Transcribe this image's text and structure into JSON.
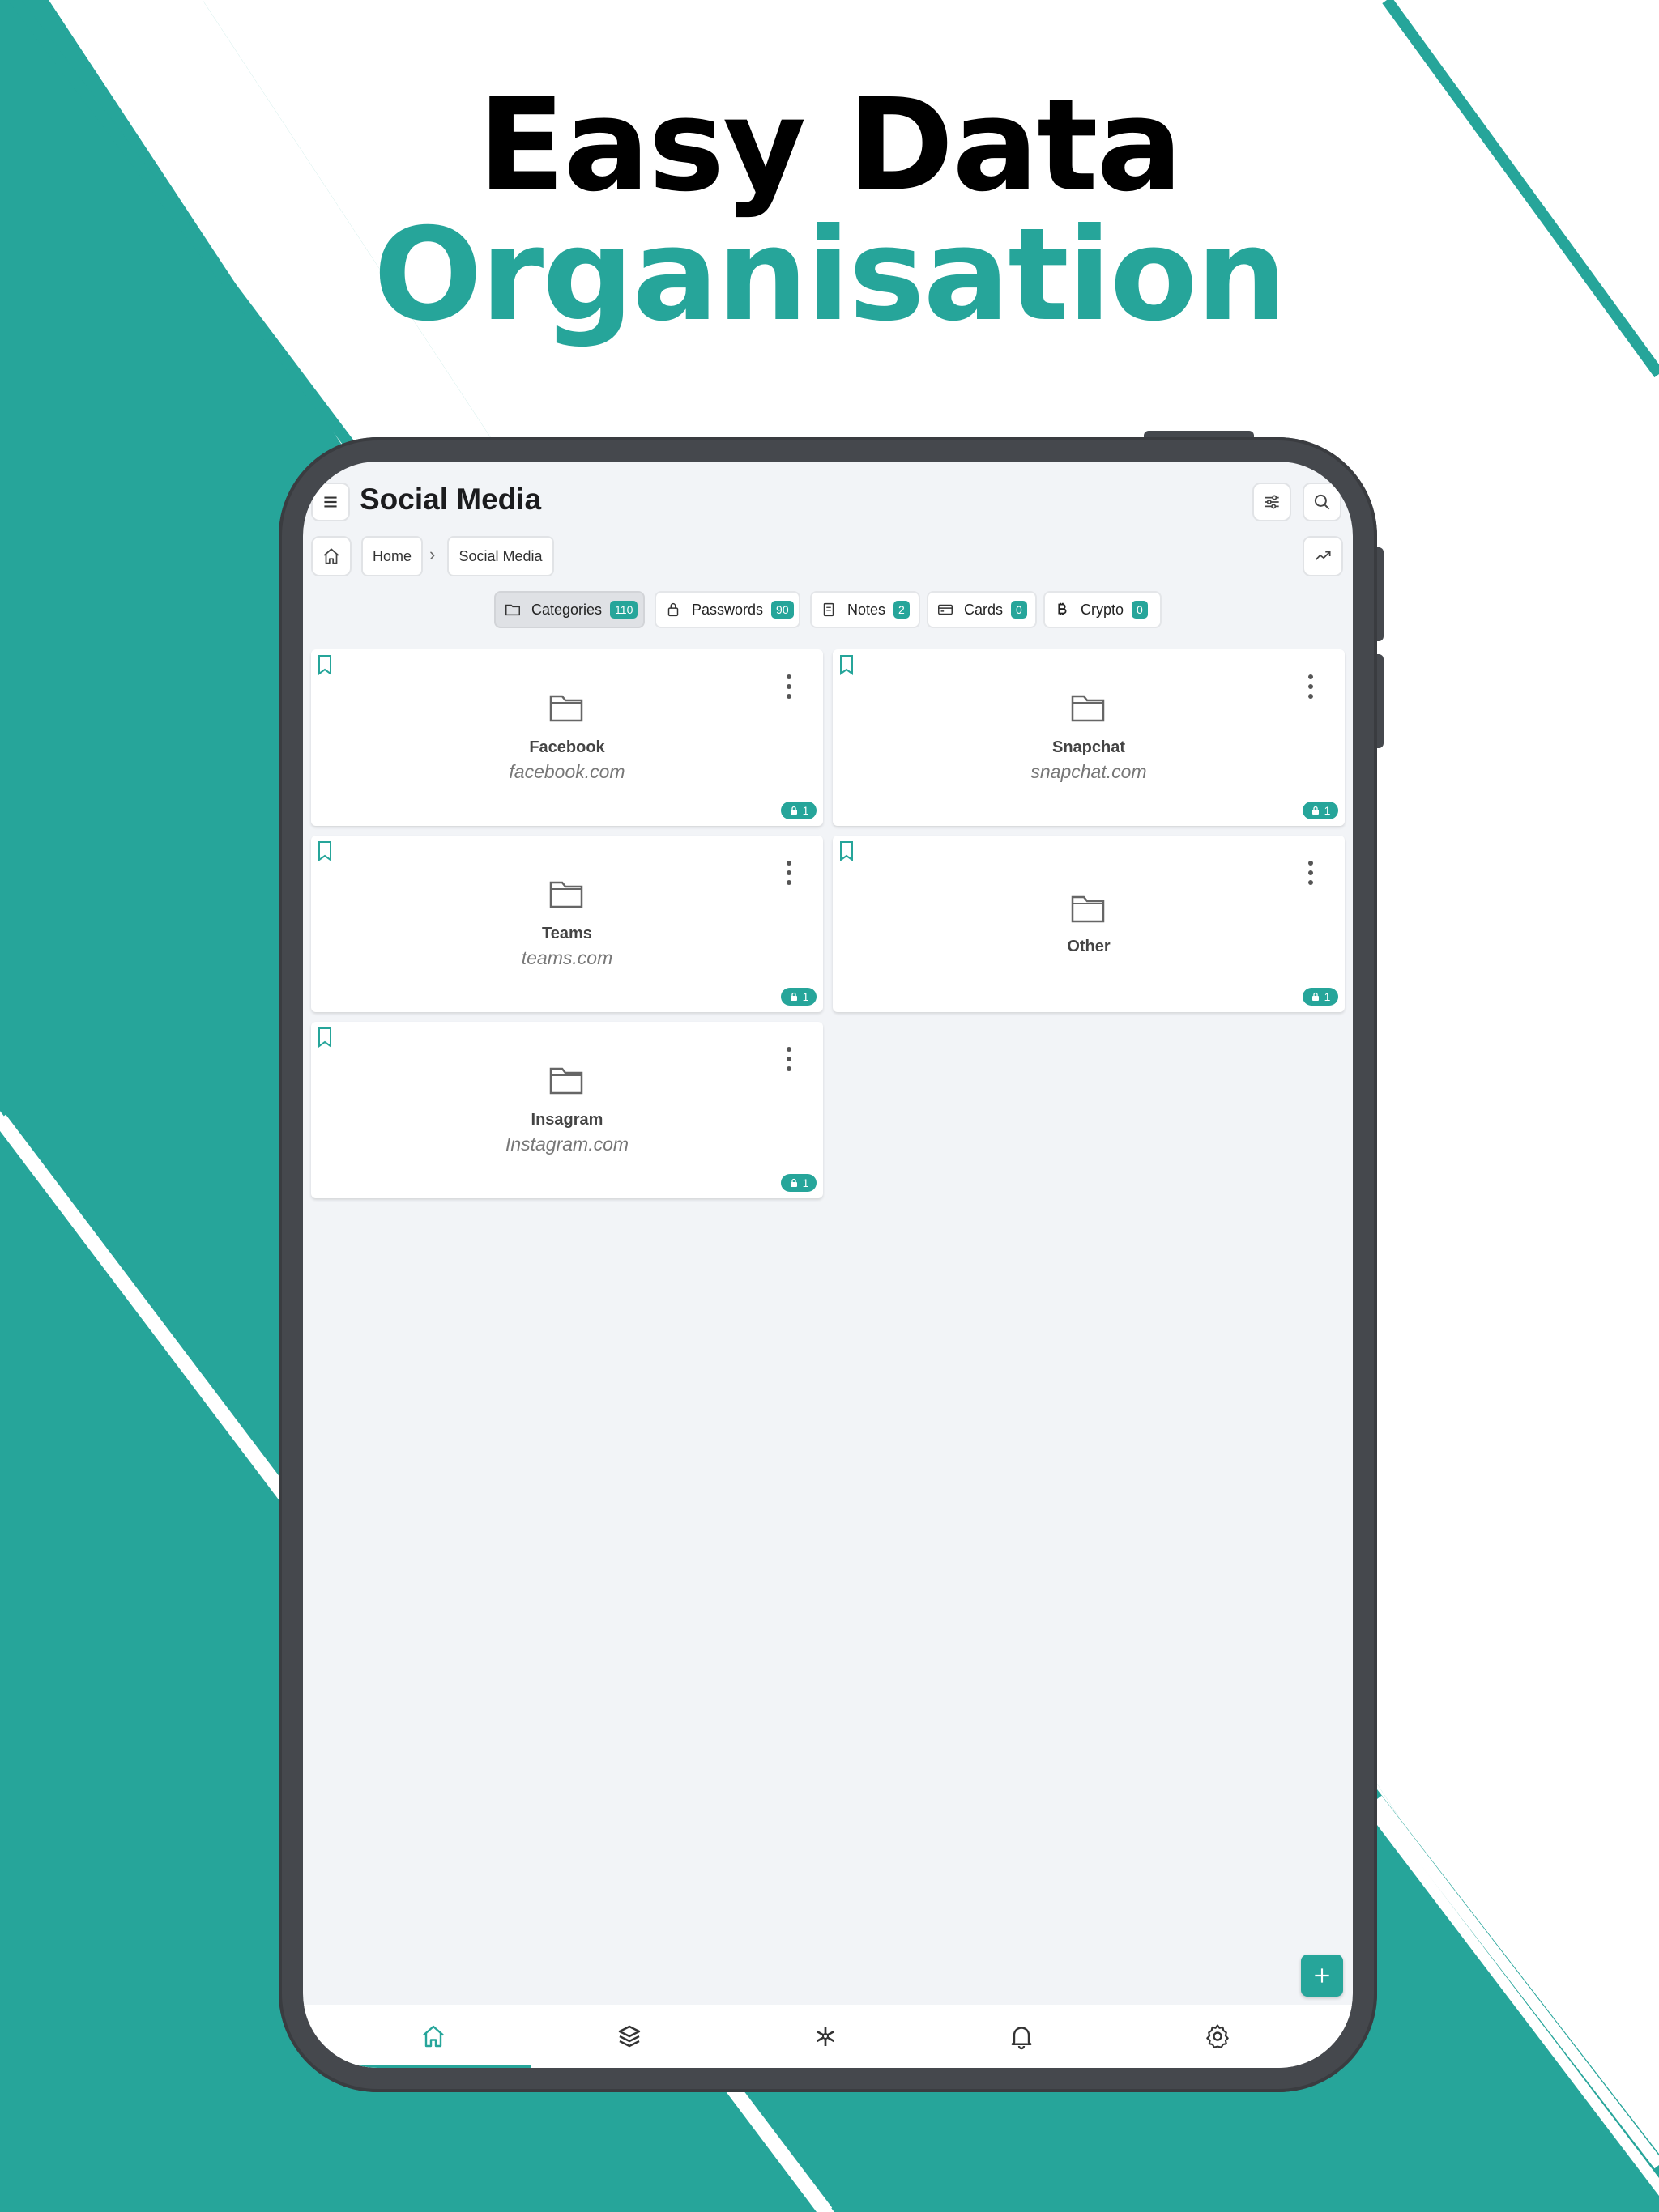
{
  "promo": {
    "headline_line1": "Easy Data",
    "headline_line2": "Organisation"
  },
  "colors": {
    "accent": "#26a59a",
    "headline_dark": "#000000",
    "device_frame": "#45484d",
    "screen_bg": "#f2f4f7"
  },
  "app": {
    "title": "Social Media",
    "header_left_icon": "menu-icon",
    "header_right_icons": [
      "sliders-icon",
      "search-icon"
    ],
    "breadcrumb": {
      "home_icon": "home-icon",
      "items": [
        "Home",
        "Social Media"
      ],
      "separator": "›",
      "right_icon": "trending-up-icon"
    },
    "tabs": [
      {
        "label": "Categories",
        "count": "110",
        "icon": "folder-icon",
        "active": true
      },
      {
        "label": "Passwords",
        "count": "90",
        "icon": "lock-icon",
        "active": false
      },
      {
        "label": "Notes",
        "count": "2",
        "icon": "note-icon",
        "active": false
      },
      {
        "label": "Cards",
        "count": "0",
        "icon": "card-icon",
        "active": false
      },
      {
        "label": "Crypto",
        "count": "0",
        "icon": "bitcoin-icon",
        "active": false
      }
    ],
    "categories": [
      {
        "name": "Facebook",
        "url": "facebook.com",
        "count": "1"
      },
      {
        "name": "Snapchat",
        "url": "snapchat.com",
        "count": "1"
      },
      {
        "name": "Teams",
        "url": "teams.com",
        "count": "1"
      },
      {
        "name": "Other",
        "url": "",
        "count": "1"
      },
      {
        "name": "Insagram",
        "url": "Instagram.com",
        "count": "1"
      }
    ],
    "fab_icon": "plus-icon",
    "bottom_nav": [
      {
        "icon": "home-icon",
        "active": true
      },
      {
        "icon": "layers-icon",
        "active": false
      },
      {
        "icon": "asterisk-icon",
        "active": false
      },
      {
        "icon": "bell-icon",
        "active": false
      },
      {
        "icon": "gear-icon",
        "active": false
      }
    ]
  }
}
